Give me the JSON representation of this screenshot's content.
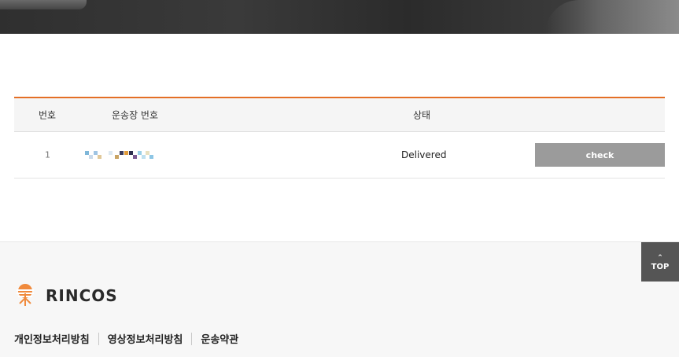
{
  "table": {
    "headers": [
      "번호",
      "운송장 번호",
      "상태"
    ],
    "rows": [
      {
        "no": "1",
        "waybill": "",
        "status": "Delivered",
        "action_label": "check"
      }
    ]
  },
  "footer": {
    "logo_text": "RINCOS",
    "links": [
      "개인정보처리방침",
      "영상정보처리방침",
      "운송약관"
    ]
  },
  "top_button": {
    "label": "TOP",
    "icon": "chevron-up-icon"
  },
  "colors": {
    "accent": "#e46f25",
    "button_gray": "#9b9b9b",
    "top_button": "#555555"
  }
}
